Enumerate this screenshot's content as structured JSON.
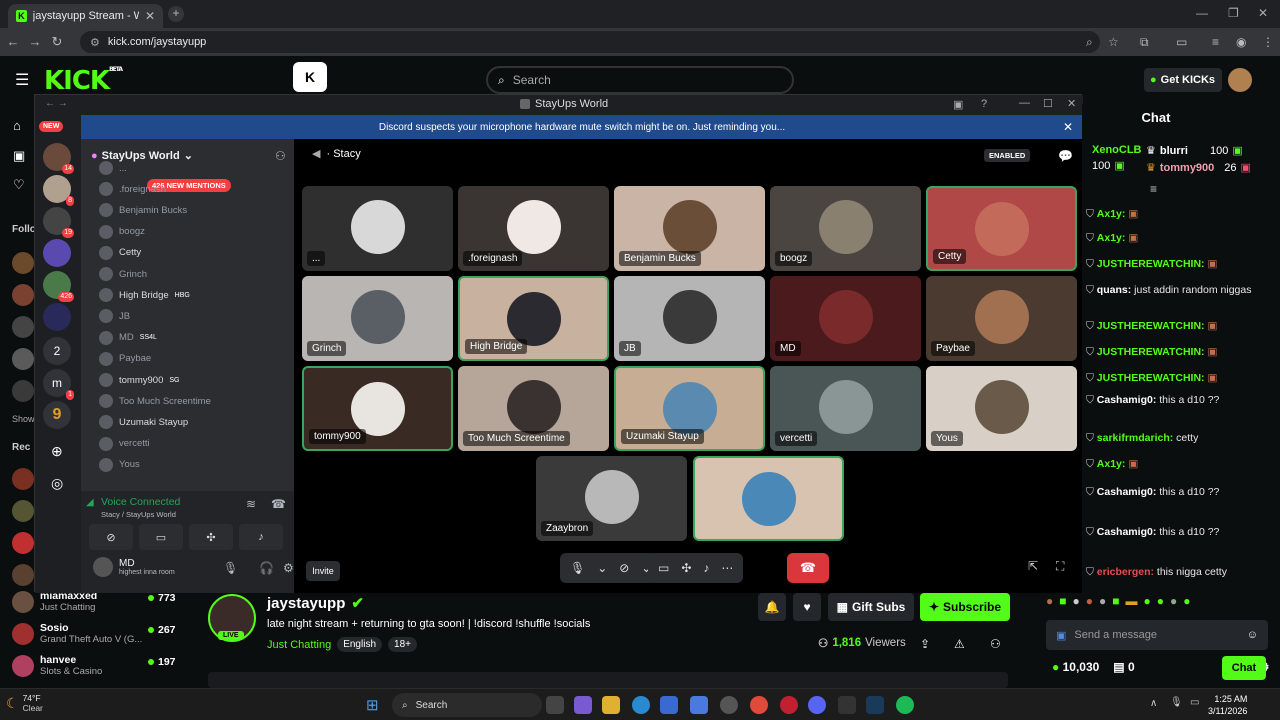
{
  "browser": {
    "tab_title": "jaystayupp Stream - Watch Live",
    "url": "kick.com/jaystayupp"
  },
  "kick": {
    "logo": "KICK",
    "logo_badge": "BETA",
    "search_placeholder": "Search",
    "get_kicks": "Get KICKs",
    "sidebar": {
      "new_badge": "NEW",
      "follow_label": "Follo",
      "show_label": "Show",
      "rec_label": "Rec",
      "recommended": [
        {
          "name": "miamaxxed",
          "category": "Just Chatting",
          "viewers": "773"
        },
        {
          "name": "Sosio",
          "category": "Grand Theft Auto V (G...",
          "viewers": "267"
        },
        {
          "name": "hanvee",
          "category": "Slots & Casino",
          "viewers": "197"
        }
      ]
    },
    "stream": {
      "streamer": "jaystayupp",
      "live": "LIVE",
      "title": "late night stream + returning to gta soon! | !discord !shuffle !socials",
      "category": "Just Chatting",
      "tags": [
        "English",
        "18+"
      ],
      "viewers": "1,816",
      "viewers_label": "Viewers",
      "gift_subs": "Gift Subs",
      "subscribe": "Subscribe"
    },
    "chat": {
      "title": "Chat",
      "gifters": [
        {
          "name": "XenoCLB",
          "count": "100"
        },
        {
          "name": "blurri",
          "count": "100"
        },
        {
          "name": "tommy900",
          "count": "26"
        }
      ],
      "messages": [
        {
          "user": "Ax1y:",
          "text": "",
          "color": "#53fc18"
        },
        {
          "user": "Ax1y:",
          "text": "",
          "color": "#53fc18"
        },
        {
          "user": "JUSTHEREWATCHIN:",
          "text": "",
          "color": "#53fc18"
        },
        {
          "user": "quans:",
          "text": "just addin random niggas",
          "color": "#ffffff"
        },
        {
          "user": "JUSTHEREWATCHIN:",
          "text": "",
          "color": "#53fc18"
        },
        {
          "user": "JUSTHEREWATCHIN:",
          "text": "",
          "color": "#53fc18"
        },
        {
          "user": "JUSTHEREWATCHIN:",
          "text": "",
          "color": "#53fc18"
        },
        {
          "user": "Cashamig0:",
          "text": "this a d10 ??",
          "color": "#ffffff"
        },
        {
          "user": "sarkifrmdarich:",
          "text": "cetty",
          "color": "#53fc18"
        },
        {
          "user": "Ax1y:",
          "text": "",
          "color": "#53fc18"
        },
        {
          "user": "Cashamig0:",
          "text": "this a d10 ??",
          "color": "#ffffff"
        },
        {
          "user": "Cashamig0:",
          "text": "this a d10 ??",
          "color": "#ffffff"
        },
        {
          "user": "ericbergen:",
          "text": "this nigga cetty",
          "color": "#e05050"
        }
      ],
      "input_placeholder": "Send a message",
      "kicks_balance": "10,030",
      "other_count": "0",
      "chat_button": "Chat"
    }
  },
  "discord": {
    "window_title": "StayUps World",
    "notice": "Discord suspects your microphone hardware mute switch might be on. Just reminding you...",
    "server_name": "StayUps World",
    "mentions_badge": "426 NEW MENTIONS",
    "server_badges": [
      "14",
      "8",
      "19",
      "426",
      "1"
    ],
    "server_letters": [
      "2",
      "m",
      "9"
    ],
    "channel": "Stacy",
    "enabled_badge": "ENABLED",
    "members": [
      {
        "name": "...",
        "tag": "",
        "online": false
      },
      {
        "name": ".foreignash",
        "tag": "",
        "online": false
      },
      {
        "name": "Benjamin Bucks",
        "tag": "",
        "online": false
      },
      {
        "name": "boogz",
        "tag": "",
        "online": false
      },
      {
        "name": "Cetty",
        "tag": "",
        "online": true
      },
      {
        "name": "Grinch",
        "tag": "",
        "online": false
      },
      {
        "name": "High Bridge",
        "tag": "HBG",
        "online": true
      },
      {
        "name": "JB",
        "tag": "",
        "online": false
      },
      {
        "name": "MD",
        "tag": "SS4L",
        "online": false
      },
      {
        "name": "Paybae",
        "tag": "",
        "online": false
      },
      {
        "name": "tommy900",
        "tag": "SG",
        "online": true
      },
      {
        "name": "Too Much Screentime",
        "tag": "",
        "online": false
      },
      {
        "name": "Uzumaki Stayup",
        "tag": "",
        "online": true
      },
      {
        "name": "vercetti",
        "tag": "",
        "online": false
      },
      {
        "name": "Yous",
        "tag": "",
        "online": false
      }
    ],
    "voice": {
      "status": "Voice Connected",
      "location": "Stacy / StayUps World",
      "user": "MD",
      "user_status": "highest inna room"
    },
    "tiles": [
      {
        "label": "...",
        "bg": "#2f2f2f",
        "face": "#d8d8d8",
        "hl": false
      },
      {
        "label": ".foreignash",
        "bg": "#3a3532",
        "face": "#f0e8e4",
        "hl": false
      },
      {
        "label": "Benjamin Bucks",
        "bg": "#c9b4a6",
        "face": "#6b4e38",
        "hl": false
      },
      {
        "label": "boogz",
        "bg": "#4a4540",
        "face": "#8a8070",
        "hl": false
      },
      {
        "label": "Cetty",
        "bg": "#b04848",
        "face": "#c46a5a",
        "hl": true
      },
      {
        "label": "Grinch",
        "bg": "#b9b5b3",
        "face": "#5a5f66",
        "hl": false
      },
      {
        "label": "High Bridge",
        "bg": "#c8b19e",
        "face": "#2a2a30",
        "hl": true
      },
      {
        "label": "JB",
        "bg": "#b5b5b5",
        "face": "#3a3a3a",
        "hl": false
      },
      {
        "label": "MD",
        "bg": "#4a1a1c",
        "face": "#7a2a2a",
        "hl": false
      },
      {
        "label": "Paybae",
        "bg": "#4a3a30",
        "face": "#a07050",
        "hl": false
      },
      {
        "label": "tommy900",
        "bg": "#3a2a24",
        "face": "#e8e4e0",
        "hl": true
      },
      {
        "label": "Too Much Screentime",
        "bg": "#b6a69a",
        "face": "#3a3230",
        "hl": false
      },
      {
        "label": "Uzumaki Stayup",
        "bg": "#c8ad95",
        "face": "#5a8ab0",
        "hl": true
      },
      {
        "label": "vercetti",
        "bg": "#4a5656",
        "face": "#8a9696",
        "hl": false
      },
      {
        "label": "Yous",
        "bg": "#d8d0c6",
        "face": "#6a5a4a",
        "hl": false
      },
      {
        "label": "Zaaybron",
        "bg": "#3a3a3a",
        "face": "#b8b8b8",
        "hl": false
      },
      {
        "label": "",
        "bg": "#d8c2b0",
        "face": "#4a88b8",
        "hl": true
      }
    ],
    "invite": "Invite"
  },
  "taskbar": {
    "temp": "74°F",
    "weather": "Clear",
    "search": "Search",
    "time": "1:25 AM",
    "date": "3/11/2026"
  }
}
